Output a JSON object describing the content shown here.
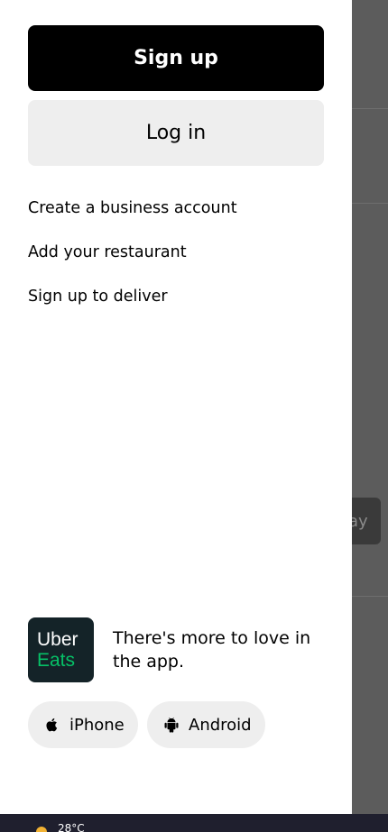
{
  "drawer": {
    "signup_label": "Sign up",
    "login_label": "Log in",
    "links": [
      "Create a business account",
      "Add your restaurant",
      "Sign up to deliver"
    ]
  },
  "app_promo": {
    "logo_line1": "Uber",
    "logo_line2": "Eats",
    "text": "There's more to love in the app.",
    "iphone_label": "iPhone",
    "android_label": "Android"
  },
  "background": {
    "pill_text": "ay"
  },
  "taskbar": {
    "temperature": "28°C"
  },
  "colors": {
    "primary_button": "#000000",
    "secondary_button": "#eeeeee",
    "logo_bg": "#142328",
    "logo_green": "#06c167",
    "overlay": "#5c5c5c"
  },
  "icons": [
    "apple-icon",
    "android-icon",
    "weather-sun-icon"
  ]
}
